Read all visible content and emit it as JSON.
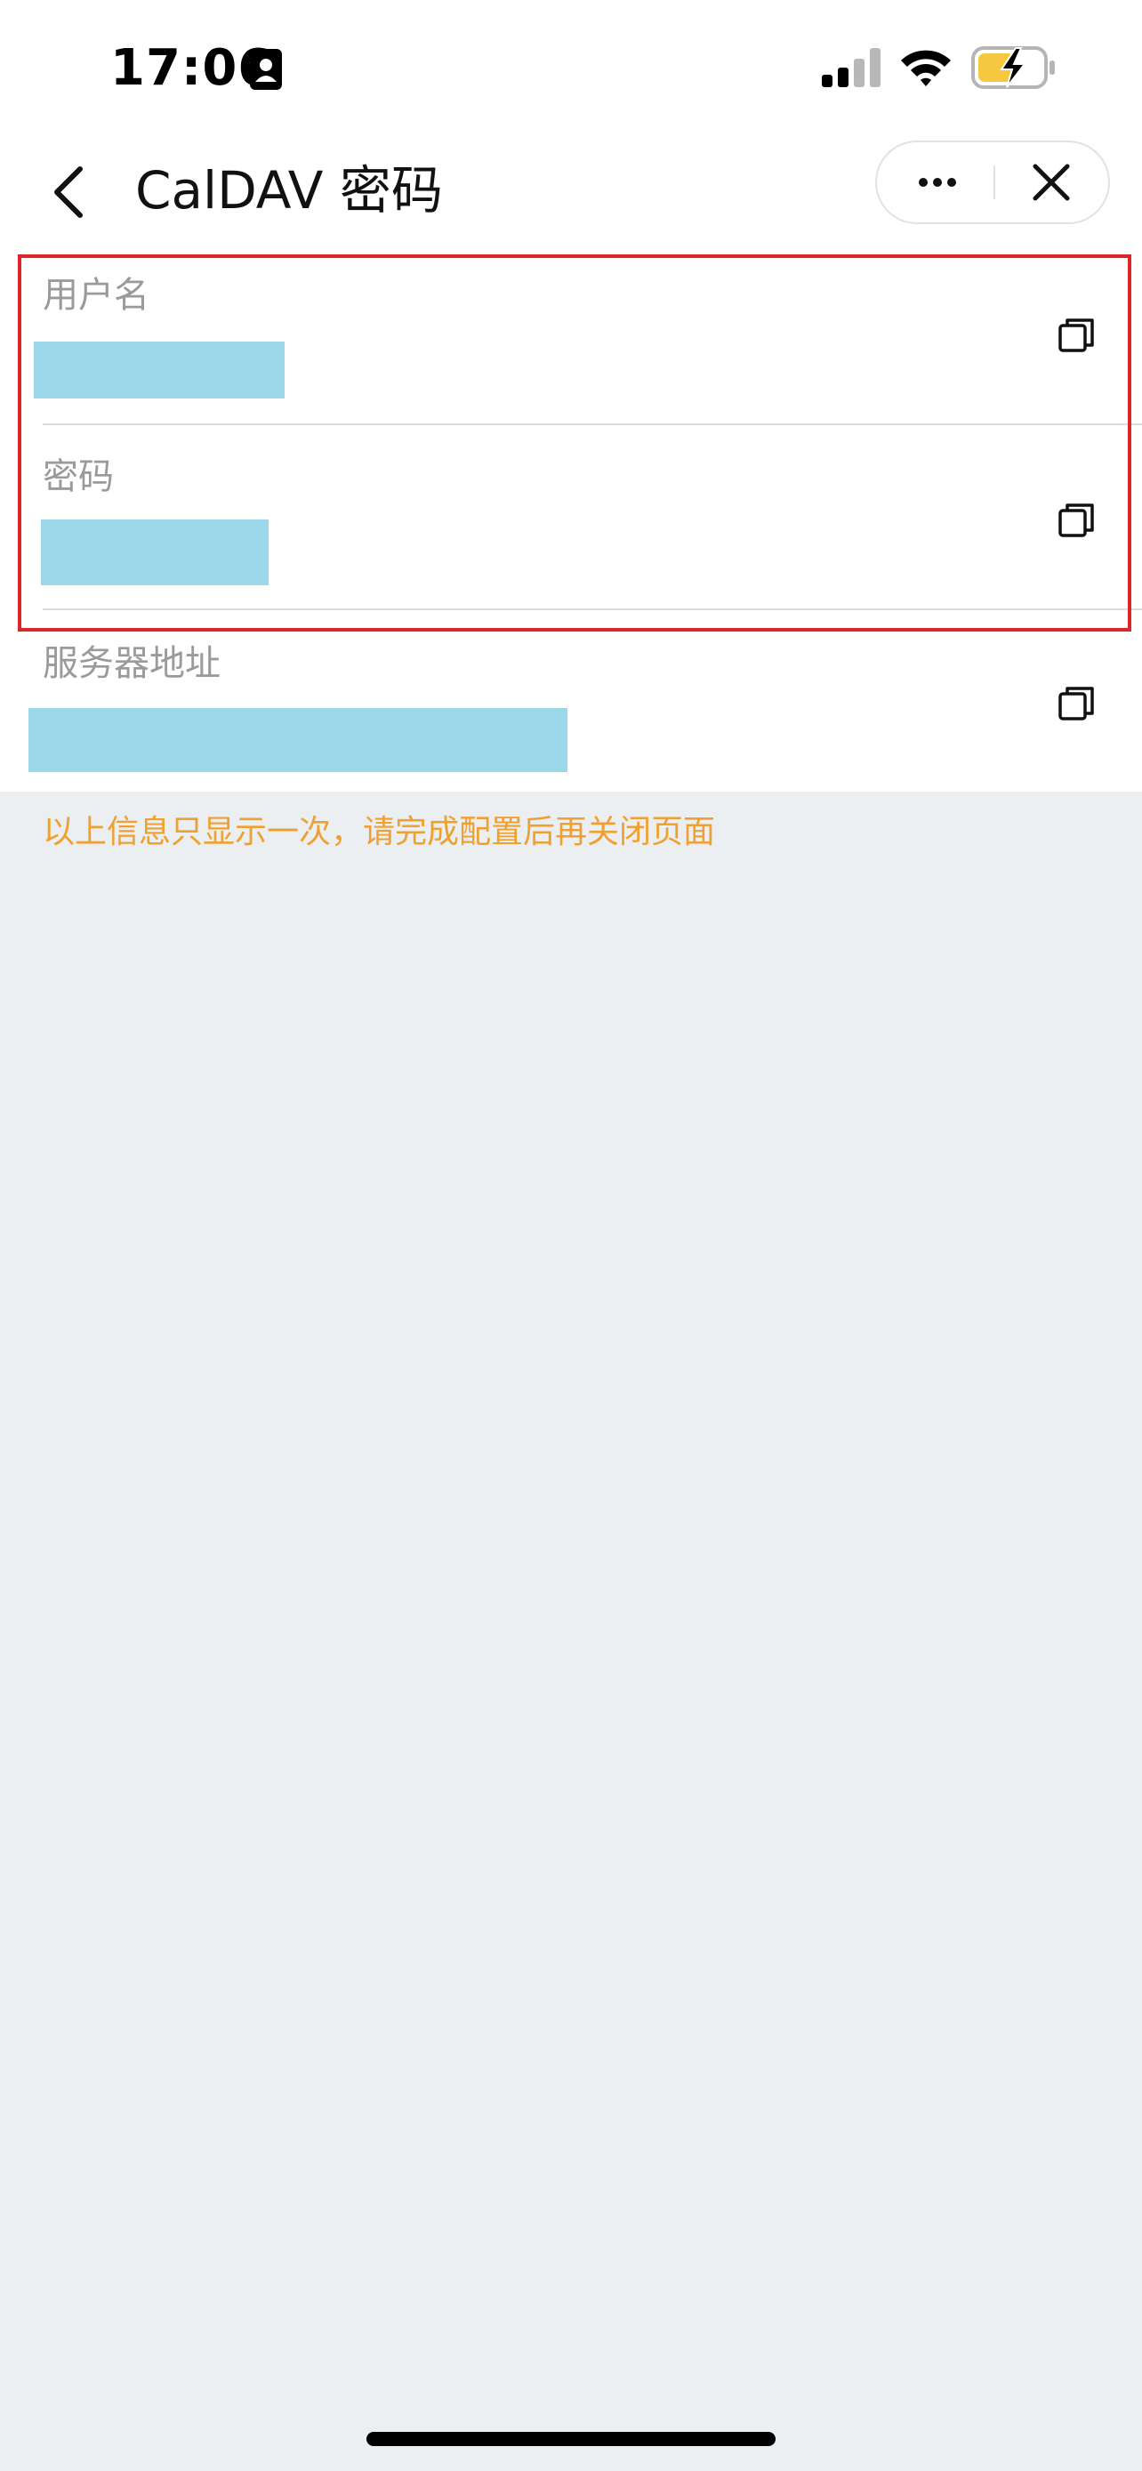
{
  "status_bar": {
    "time": "17:06",
    "icons": [
      "contact-card-icon",
      "cell-signal-icon",
      "wifi-icon",
      "battery-charging-icon"
    ]
  },
  "nav": {
    "title": "CalDAV 密码",
    "icons": [
      "back-icon",
      "more-icon",
      "close-icon"
    ]
  },
  "fields": [
    {
      "label": "用户名",
      "value_redacted": true
    },
    {
      "label": "密码",
      "value_redacted": true
    },
    {
      "label": "服务器地址",
      "value_redacted": true
    }
  ],
  "notice": "以上信息只显示一次，请完成配置后再关闭页面",
  "colors": {
    "highlight_border": "#E0242B",
    "notice_text": "#F0A030",
    "redaction": "#9AD8EA",
    "page_background": "#ECEFF2",
    "battery_fill": "#F5C840"
  }
}
